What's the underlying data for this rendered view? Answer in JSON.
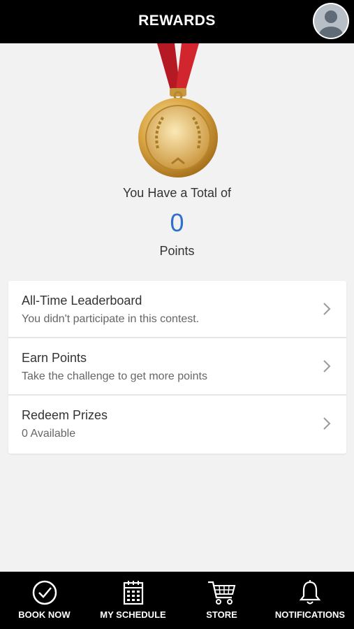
{
  "header": {
    "title": "REWARDS"
  },
  "summary": {
    "total_label": "You Have a Total of",
    "points_value": "0",
    "points_label": "Points"
  },
  "menu": [
    {
      "title": "All-Time Leaderboard",
      "subtitle": "You didn't participate in this contest."
    },
    {
      "title": "Earn Points",
      "subtitle": "Take the challenge to get more points"
    },
    {
      "title": "Redeem Prizes",
      "subtitle": "0 Available"
    }
  ],
  "tabs": [
    {
      "label": "BOOK NOW",
      "icon": "check-circle-icon"
    },
    {
      "label": "MY SCHEDULE",
      "icon": "calendar-icon"
    },
    {
      "label": "STORE",
      "icon": "cart-icon"
    },
    {
      "label": "NOTIFICATIONS",
      "icon": "bell-icon"
    }
  ],
  "colors": {
    "header_bg": "#000000",
    "points_accent": "#2f6fcf",
    "ribbon": "#c8202a",
    "medal_gold": "#d9a441"
  }
}
